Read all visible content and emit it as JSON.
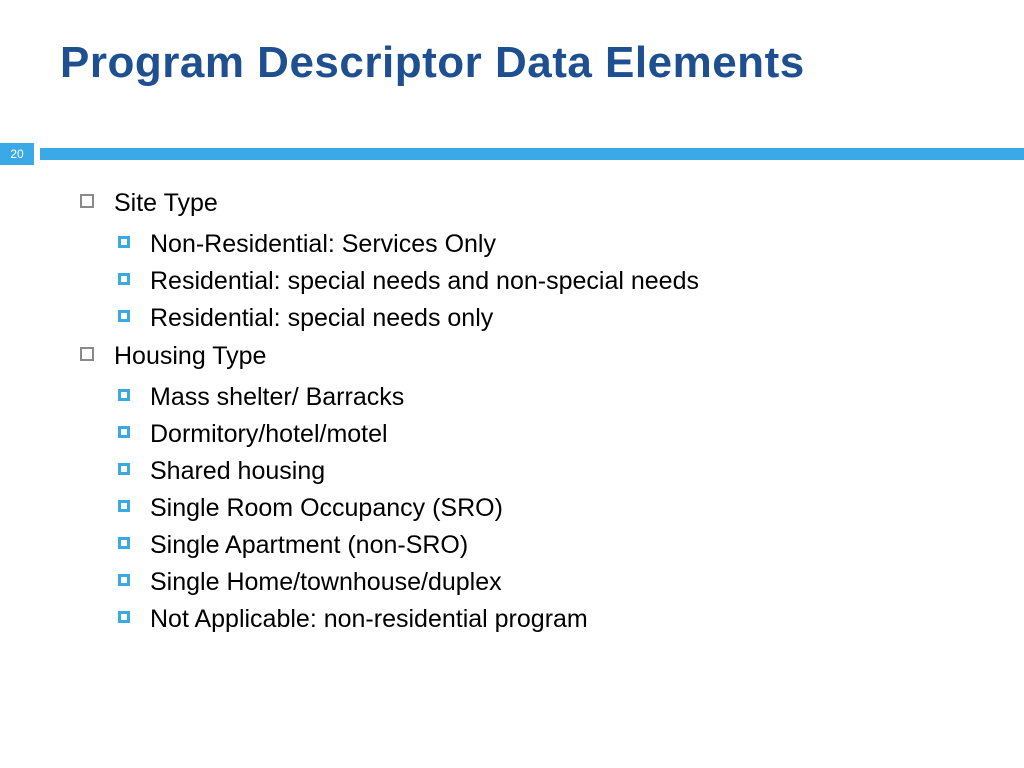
{
  "title": "Program Descriptor Data Elements",
  "page_number": "20",
  "sections": [
    {
      "heading": "Site Type",
      "items": [
        "Non-Residential: Services Only",
        "Residential: special needs and non-special needs",
        "Residential: special needs only"
      ]
    },
    {
      "heading": "Housing Type",
      "items": [
        "Mass shelter/ Barracks",
        "Dormitory/hotel/motel",
        "Shared housing",
        "Single Room Occupancy (SRO)",
        "Single Apartment (non-SRO)",
        "Single Home/townhouse/duplex",
        "Not Applicable: non-residential program"
      ]
    }
  ]
}
